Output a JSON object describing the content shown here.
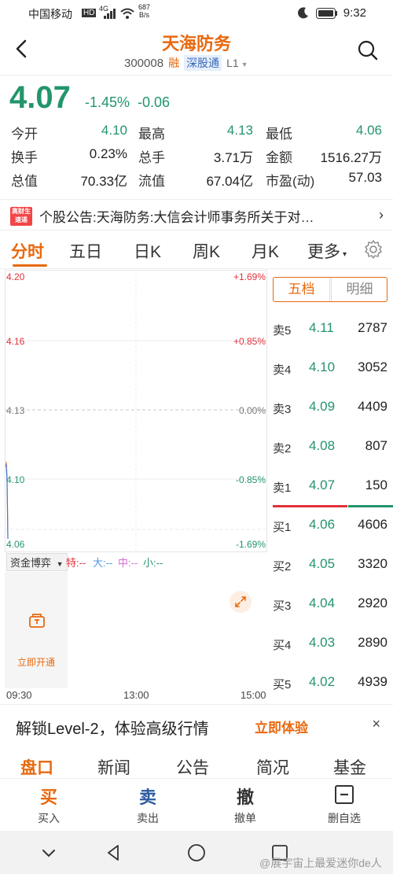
{
  "status_bar": {
    "carrier": "中国移动",
    "hd": "HD",
    "network": "4G",
    "speed_value": "687",
    "speed_unit": "B/s",
    "time": "9:32"
  },
  "header": {
    "title": "天海防务",
    "code": "300008",
    "tag_margin": "融",
    "tag_connect": "深股通",
    "level": "L1"
  },
  "quote": {
    "price": "4.07",
    "change_pct": "-1.45%",
    "change": "-0.06",
    "stats": [
      [
        {
          "label": "今开",
          "value": "4.10",
          "color": "green"
        },
        {
          "label": "最高",
          "value": "4.13",
          "color": "green"
        },
        {
          "label": "最低",
          "value": "4.06",
          "color": "green"
        }
      ],
      [
        {
          "label": "换手",
          "value": "0.23%",
          "color": "plain"
        },
        {
          "label": "总手",
          "value": "3.71万",
          "color": "plain"
        },
        {
          "label": "金额",
          "value": "1516.27万",
          "color": "plain"
        }
      ],
      [
        {
          "label": "总值",
          "value": "70.33亿",
          "color": "plain"
        },
        {
          "label": "流值",
          "value": "67.04亿",
          "color": "plain"
        },
        {
          "label": "市盈(动)",
          "value": "57.03",
          "color": "plain"
        }
      ]
    ]
  },
  "announcement": {
    "badge_line1": "高财生",
    "badge_line2": "速递",
    "text": "个股公告:天海防务:大信会计师事务所关于对…"
  },
  "chart_tabs": [
    "分时",
    "五日",
    "日K",
    "周K",
    "月K",
    "更多"
  ],
  "chart": {
    "price_labels": [
      "4.20",
      "4.16",
      "4.13",
      "4.10",
      "4.06"
    ],
    "pct_labels": [
      "+1.69%",
      "+0.85%",
      "0.00%",
      "-0.85%",
      "-1.69%"
    ],
    "time_labels": [
      "09:30",
      "13:00",
      "15:00"
    ]
  },
  "capital_flow": {
    "select_label": "资金博弈",
    "legend": [
      {
        "text": "特:--",
        "color": "#e2303c"
      },
      {
        "text": "大:--",
        "color": "#4a9be0"
      },
      {
        "text": "中:--",
        "color": "#d66ad8"
      },
      {
        "text": "小:--",
        "color": "#23956b"
      }
    ],
    "unlock_label": "立即开通"
  },
  "order_book": {
    "tab_active": "五档",
    "tab_inactive": "明细",
    "asks": [
      {
        "label": "卖5",
        "price": "4.11",
        "vol": "2787",
        "color": "green"
      },
      {
        "label": "卖4",
        "price": "4.10",
        "vol": "3052",
        "color": "green"
      },
      {
        "label": "卖3",
        "price": "4.09",
        "vol": "4409",
        "color": "green"
      },
      {
        "label": "卖2",
        "price": "4.08",
        "vol": "807",
        "color": "green"
      },
      {
        "label": "卖1",
        "price": "4.07",
        "vol": "150",
        "color": "green"
      }
    ],
    "bids": [
      {
        "label": "买1",
        "price": "4.06",
        "vol": "4606",
        "color": "green"
      },
      {
        "label": "买2",
        "price": "4.05",
        "vol": "3320",
        "color": "green"
      },
      {
        "label": "买3",
        "price": "4.04",
        "vol": "2920",
        "color": "green"
      },
      {
        "label": "买4",
        "price": "4.03",
        "vol": "2890",
        "color": "green"
      },
      {
        "label": "买5",
        "price": "4.02",
        "vol": "4939",
        "color": "green"
      }
    ]
  },
  "level2_banner": {
    "text": "解锁Level-2，体验高级行情",
    "link": "立即体验",
    "close": "×"
  },
  "section_tabs": [
    "盘口",
    "新闻",
    "公告",
    "简况",
    "基金"
  ],
  "trade_bar": [
    {
      "big": "买",
      "small": "买入",
      "color": "#e8690e"
    },
    {
      "big": "卖",
      "small": "卖出",
      "color": "#2c5aa0"
    },
    {
      "big": "撤",
      "small": "撤单",
      "color": "#333333"
    },
    {
      "big": "",
      "small": "删自选",
      "color": "#333333"
    }
  ],
  "watermark": "@展宇宙上最爱迷你de人",
  "colors": {
    "accent": "#e8690e",
    "down": "#23956b",
    "up": "#e2303c"
  }
}
